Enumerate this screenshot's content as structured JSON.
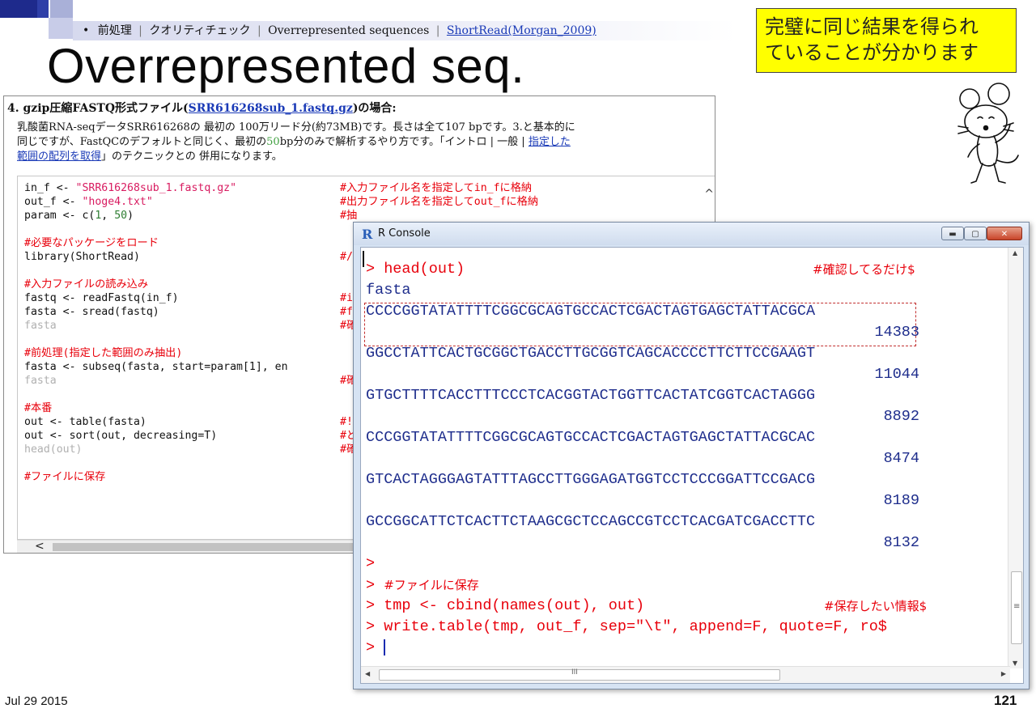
{
  "slide": {
    "bullet": "•",
    "breadcrumb": [
      "前処理",
      "クオリティチェック",
      "Overrepresented sequences"
    ],
    "breadcrumb_sep": "|",
    "breadcrumb_link": "ShortRead(Morgan_2009)",
    "title": "Overrepresented seq.",
    "callout": [
      "完璧に同じ結果を得られ",
      "ていることが分かります"
    ],
    "date": "Jul 29 2015",
    "page_number": "121"
  },
  "web_panel": {
    "heading_prefix": "4. gzip圧縮FASTQ形式ファイル(",
    "heading_link": "SRR616268sub_1.fastq.gz",
    "heading_suffix": ")の場合:",
    "desc": [
      "乳酸菌RNA-seqデータSRR616268の 最初の 100万リード分(約73MB)です。長さは全て107 bpです。3.と基本的に",
      "同じですが、FastQCのデフォルトと同じく、最初の",
      "50",
      "bp分のみで解析するやり方です。「イントロ | 一般 | ",
      "指定した",
      "範囲の配列を取得",
      "」のテクニックとの 併用になります。"
    ],
    "code_lines": [
      [
        "in_f <- ",
        "\"SRR616268sub_1.fastq.gz\""
      ],
      [
        "out_f <- ",
        "\"hoge4.txt\""
      ],
      [
        "param <- c(",
        "1",
        ", ",
        "50",
        ")"
      ],
      [
        ""
      ],
      [
        "#必要なパッケージをロード"
      ],
      [
        "library(ShortRead)"
      ],
      [
        ""
      ],
      [
        "#入力ファイルの読み込み"
      ],
      [
        "fastq <- readFastq(in_f)"
      ],
      [
        "fasta <- sread(fastq)"
      ],
      [
        "fasta"
      ],
      [
        ""
      ],
      [
        "#前処理(指定した範囲のみ抽出)"
      ],
      [
        "fasta <- subseq(fasta, start=param[1], en"
      ],
      [
        "fasta"
      ],
      [
        ""
      ],
      [
        "#本番"
      ],
      [
        "out <- table(fasta)"
      ],
      [
        "out <- sort(out, decreasing=T)"
      ],
      [
        "head(out)"
      ],
      [
        ""
      ],
      [
        "#ファイルに保存"
      ]
    ],
    "code_comments": [
      "#入力ファイル名を指定してin_fに格納",
      "#出力ファイル名を指定してout_fに格納",
      "#抽",
      "",
      "",
      "#/",
      "",
      "",
      "#i",
      "#f",
      "#確",
      "",
      "",
      "",
      "#確",
      "",
      "",
      "#!",
      "#ど",
      "#確",
      "",
      ""
    ],
    "scroll_left": "<",
    "scroll_up": "^"
  },
  "rconsole": {
    "logo": "R",
    "title": "R Console",
    "btn_min": "▬",
    "btn_max": "▢",
    "btn_close": "✕",
    "lines": [
      "> head(out)",
      "fasta",
      "CCCCGGTATATTTTCGGCGCAGTGCCACTCGACTAGTGAGCTATTACGCA",
      "14383",
      "GGCCTATTCACTGCGGCTGACCTTGCGGTCAGCACCCCTTCTTCCGAAGT",
      "11044",
      "GTGCTTTTCACCTTTCCCTCACGGTACTGGTTCACTATCGGTCACTAGGG",
      "8892",
      "CCCGGTATATTTTCGGCGCAGTGCCACTCGACTAGTGAGCTATTACGCAC",
      "8474",
      "GTCACTAGGGAGTATTTAGCCTTGGGAGATGGTCCTCCCGGATTCCGACG",
      "8189",
      "GCCGGCATTCTCACTTCTAAGCGCTCCAGCCGTCCTCACGATCGACCTTC",
      "8132",
      ">",
      "> ",
      "> tmp <- cbind(names(out), out)",
      "> write.table(tmp, out_f, sep=\"\\t\", append=F, quote=F, ro$",
      "> "
    ],
    "comment_save_jp": "#ファイルに保存",
    "comment_head": "#確認してるだけ$",
    "comment_tmp": "#保存したい情報$",
    "scroll_up": "▲",
    "scroll_down": "▼",
    "scroll_left": "◀",
    "scroll_right": "▶",
    "grip_v": "≡",
    "grip_h": "III"
  }
}
